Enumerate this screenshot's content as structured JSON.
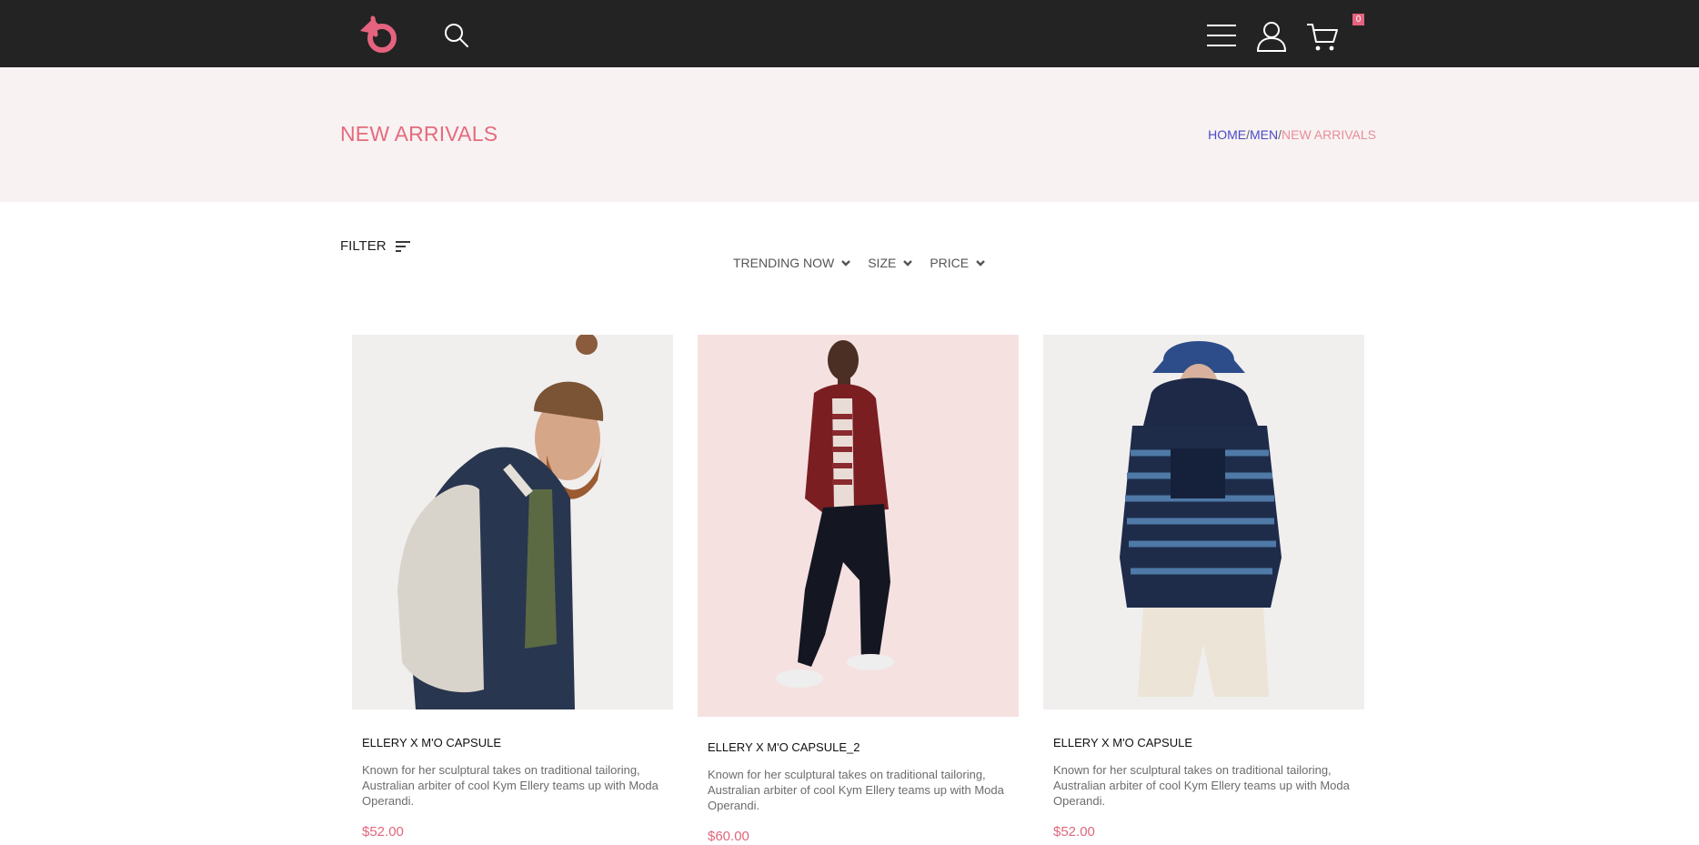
{
  "header": {
    "logo_icon": "brand-logo-icon",
    "search_icon": "search-icon",
    "menu_icon": "hamburger-menu-icon",
    "user_icon": "user-icon",
    "cart_icon": "cart-icon",
    "cart_count": "0",
    "accent": "#e5637f",
    "background": "#232323"
  },
  "hero": {
    "title": "NEW ARRIVALS",
    "breadcrumb": {
      "home": "HOME",
      "separator": "/",
      "men": "MEN",
      "current": "NEW ARRIVALS"
    }
  },
  "toolbar": {
    "filter_label": "FILTER",
    "sorts": [
      {
        "label": "TRENDING NOW"
      },
      {
        "label": "SIZE"
      },
      {
        "label": "PRICE"
      }
    ]
  },
  "products": [
    {
      "title": "ELLERY X M'O CAPSULE",
      "description": "Known for her sculptural takes on traditional tailoring, Australian arbiter of cool Kym Ellery teams up with Moda Operandi.",
      "price": "$52.00",
      "image_bg": "#f1eeee"
    },
    {
      "title": "ELLERY X M'O CAPSULE_2",
      "description": "Known for her sculptural takes on traditional tailoring, Australian arbiter of cool Kym Ellery teams up with Moda Operandi.",
      "price": "$60.00",
      "image_bg": "#f6e1e1"
    },
    {
      "title": "ELLERY X M'O CAPSULE",
      "description": "Known for her sculptural takes on traditional tailoring, Australian arbiter of cool Kym Ellery teams up with Moda Operandi.",
      "price": "$52.00",
      "image_bg": "#f1eeee"
    }
  ]
}
